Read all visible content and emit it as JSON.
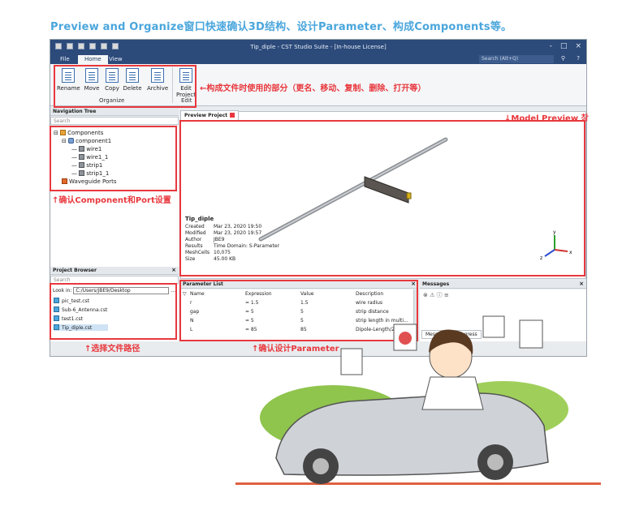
{
  "headline": "Preview and Organize窗口快速确认3D结构、设计Parameter、构成Components等。",
  "window": {
    "title": "Tip_diple - CST Studio Suite - [In-house License]",
    "controls": [
      "-",
      "□",
      "×"
    ]
  },
  "menu": {
    "tabs": [
      "File",
      "Home",
      "View"
    ],
    "active": "Home",
    "search_placeholder": "Search (Alt+Q)"
  },
  "ribbon": {
    "organize_buttons": [
      "Rename",
      "Move",
      "Copy",
      "Delete"
    ],
    "archive": "Archive",
    "edit_project": [
      "Edit",
      "Project"
    ],
    "group_organize": "Organize",
    "group_edit": "Edit"
  },
  "annotations": {
    "ribbon": "←构成文件时使用的部分（更名、移动、复制、删除、打开等）",
    "preview": "↓Model Preview 창",
    "tree": "↑确认Component和Port设置",
    "browser": "↑选择文件路径",
    "params": "↑确认设计Parameter"
  },
  "navigation_tree": {
    "title": "Navigation Tree",
    "close": "×",
    "search_placeholder": "Search",
    "items": [
      {
        "label": "Components",
        "icon": "folder-icon"
      },
      {
        "label": "component1",
        "icon": "component-icon"
      },
      {
        "label": "wire1",
        "icon": "solid-icon"
      },
      {
        "label": "wire1_1",
        "icon": "solid-icon"
      },
      {
        "label": "strip1",
        "icon": "solid-icon"
      },
      {
        "label": "strip1_1",
        "icon": "solid-icon"
      },
      {
        "label": "Waveguide Ports",
        "icon": "port-icon"
      }
    ]
  },
  "project_browser": {
    "title": "Project Browser",
    "close": "×",
    "search_placeholder": "Search",
    "look_in_label": "Look in:",
    "look_in_value": "C:/Users/JBE9/Desktop",
    "browse_button": "...",
    "files": [
      "pic_test.cst",
      "Sub-6_Antenna.cst",
      "test1.cst",
      "Tip_diple.cst"
    ],
    "selected": "Tip_diple.cst"
  },
  "preview": {
    "tab_label": "Preview Project",
    "project_name": "Tip_diple",
    "info": [
      {
        "key": "Created",
        "value": "Mar 23, 2020 19:50"
      },
      {
        "key": "Modified",
        "value": "Mar 23, 2020 19:57"
      },
      {
        "key": "Author",
        "value": "JBE9"
      },
      {
        "key": "Results",
        "value": "Time Domain: S-Parameter"
      },
      {
        "key": "MeshCells",
        "value": "10,075"
      },
      {
        "key": "Size",
        "value": "45.00 KB"
      }
    ],
    "axes": {
      "x": "x",
      "y": "y",
      "z": "z"
    }
  },
  "parameter_list": {
    "title": "Parameter List",
    "close": "×",
    "columns": [
      "Name",
      "Expression",
      "Value",
      "Description"
    ],
    "rows": [
      {
        "name": "r",
        "expression": "= 1.5",
        "value": "1.5",
        "description": "wire radius"
      },
      {
        "name": "gap",
        "expression": "= 5",
        "value": "5",
        "description": "strip distance"
      },
      {
        "name": "N",
        "expression": "= 5",
        "value": "5",
        "description": "strip length in multi..."
      },
      {
        "name": "L",
        "expression": "= 85",
        "value": "85",
        "description": "Dipole-Length/2"
      }
    ]
  },
  "messages": {
    "title": "Messages",
    "close": "×",
    "tabs": [
      "Messages",
      "Progress"
    ]
  },
  "colors": {
    "headline": "#4aa6dc",
    "annotation_red": "#e8383d",
    "titlebar": "#2c4a7a"
  }
}
